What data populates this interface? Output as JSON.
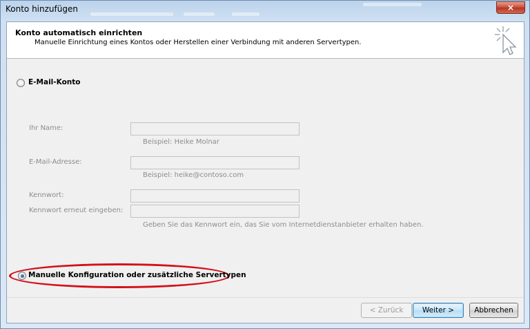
{
  "window": {
    "title": "Konto hinzufügen",
    "close_glyph": "×"
  },
  "header": {
    "title": "Konto automatisch einrichten",
    "subtitle": "Manuelle Einrichtung eines Kontos oder Herstellen einer Verbindung mit anderen Servertypen."
  },
  "options": {
    "email_account": {
      "label": "E-Mail-Konto",
      "selected": false
    },
    "manual_config": {
      "label": "Manuelle Konfiguration oder zusätzliche Servertypen",
      "selected": true
    }
  },
  "form": {
    "name": {
      "label": "Ihr Name:",
      "value": "",
      "hint": "Beispiel: Heike Molnar"
    },
    "email": {
      "label": "E-Mail-Adresse:",
      "value": "",
      "hint": "Beispiel: heike@contoso.com"
    },
    "password": {
      "label": "Kennwort:",
      "value": ""
    },
    "password_repeat": {
      "label": "Kennwort erneut eingeben:",
      "value": ""
    },
    "password_hint": "Geben Sie das Kennwort ein, das Sie vom Internetdienstanbieter erhalten haben."
  },
  "buttons": {
    "back": "< Zurück",
    "next": "Weiter >",
    "cancel": "Abbrechen"
  },
  "icons": {
    "wizard": "wizard-cursor-icon",
    "highlight_color": "#d3101a"
  }
}
